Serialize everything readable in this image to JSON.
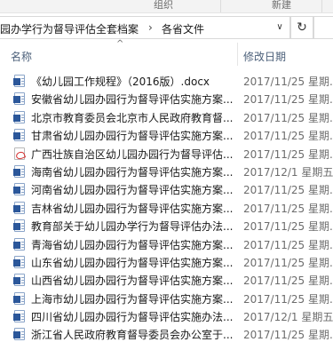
{
  "ribbon": {
    "group_label": "组织",
    "new_label": "新建"
  },
  "address_bar": {
    "path": [
      "园办学行为督导评估全套档案",
      "各省文件"
    ],
    "separator": "›",
    "dropdown_icon": "chevron-down-icon",
    "refresh_icon": "refresh-icon"
  },
  "columns": {
    "name": "名称",
    "date_modified": "修改日期",
    "sort_icon": "sort-up-icon"
  },
  "files": [
    {
      "name": "《幼儿园工作规程》（2016版）.docx",
      "date": "2017/11/25 星期...",
      "type": "word"
    },
    {
      "name": "安徽省幼儿园办园行为督导评估实施方案...",
      "date": "2017/11/25 星期...",
      "type": "word"
    },
    {
      "name": "北京市教育委员会北京市人民政府教育督...",
      "date": "2017/11/25 星期...",
      "type": "word"
    },
    {
      "name": "甘肃省幼儿园办园行为督导评估实施方案...",
      "date": "2017/11/25 星期...",
      "type": "word"
    },
    {
      "name": "广西壮族自治区幼儿园办园行为督导评估...",
      "date": "2017/11/25 星期...",
      "type": "pdf"
    },
    {
      "name": "海南省幼儿园办园行为督导评估实施方案...",
      "date": "2017/12/1 星期五...",
      "type": "word"
    },
    {
      "name": "河南省幼儿园办园行为督导评估实施方案...",
      "date": "2017/11/25 星期...",
      "type": "word"
    },
    {
      "name": "吉林省幼儿园办园行为督导评估实施方案...",
      "date": "2017/11/25 星期...",
      "type": "word"
    },
    {
      "name": "教育部关于幼儿园办学行为督导评估办法...",
      "date": "2017/11/25 星期...",
      "type": "word"
    },
    {
      "name": "青海省幼儿园办园行为督导评估实施方案...",
      "date": "2017/11/25 星期...",
      "type": "word"
    },
    {
      "name": "山东省幼儿园办园行为督导评估实施方案...",
      "date": "2017/11/25 星期...",
      "type": "word"
    },
    {
      "name": "山西省幼儿园办园行为督导评估实施方案...",
      "date": "2017/11/25 星期...",
      "type": "word"
    },
    {
      "name": "上海市幼儿园办园行为督导评估实施方案...",
      "date": "2017/11/25 星期...",
      "type": "word"
    },
    {
      "name": "四川省幼儿园办园行为督导评估实施办法...",
      "date": "2017/12/1 星期五...",
      "type": "word"
    },
    {
      "name": "浙江省人民政府教育督导委员会办公室于...",
      "date": "2017/11/25 星期...",
      "type": "word"
    }
  ]
}
